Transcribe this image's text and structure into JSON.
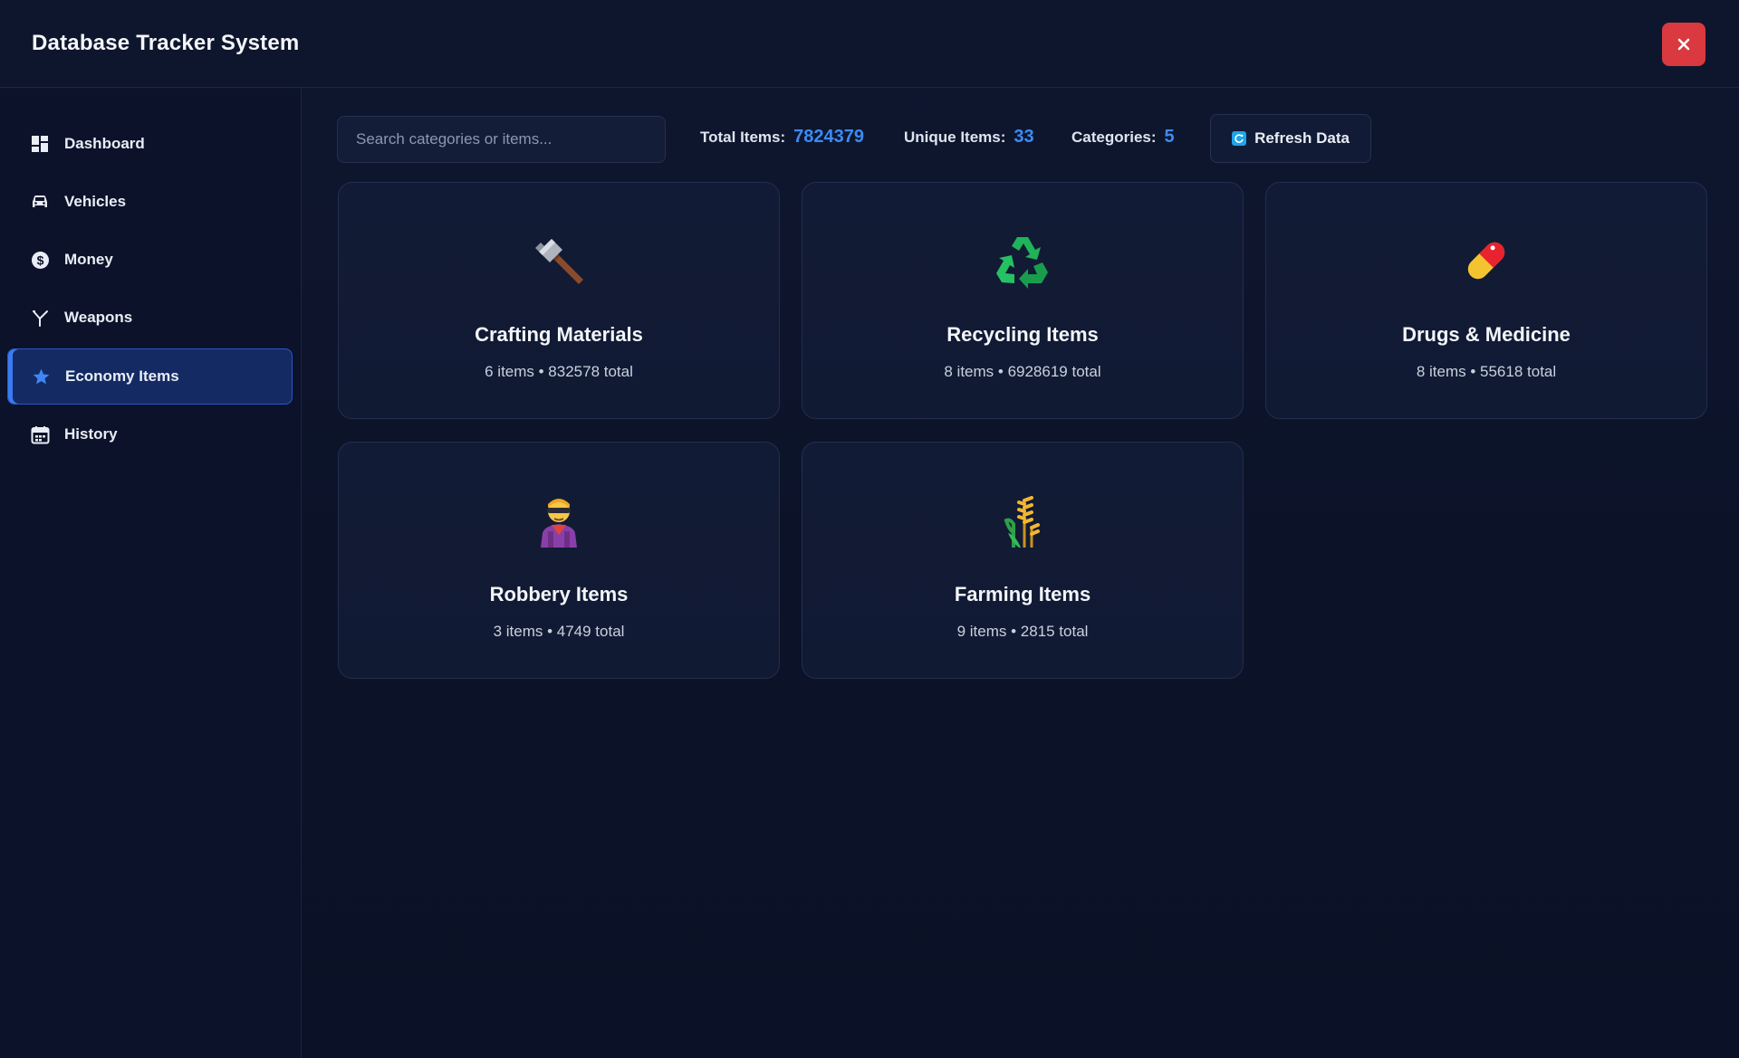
{
  "header": {
    "title": "Database Tracker System",
    "close_icon": "close-icon",
    "close_color": "#d9393f"
  },
  "sidebar": {
    "items": [
      {
        "label": "Dashboard",
        "icon": "dashboard-icon"
      },
      {
        "label": "Vehicles",
        "icon": "car-icon"
      },
      {
        "label": "Money",
        "icon": "dollar-icon"
      },
      {
        "label": "Weapons",
        "icon": "weapon-icon"
      },
      {
        "label": "Economy Items",
        "icon": "star-icon",
        "active": true
      },
      {
        "label": "History",
        "icon": "calendar-icon"
      }
    ]
  },
  "toolbar": {
    "search_placeholder": "Search categories or items...",
    "total_items_label": "Total Items:",
    "total_items_value": "7824379",
    "unique_items_label": "Unique Items:",
    "unique_items_value": "33",
    "categories_label": "Categories:",
    "categories_value": "5",
    "refresh_label": "Refresh Data",
    "accent_color": "#3d8bf2"
  },
  "categories": [
    {
      "title": "Crafting Materials",
      "meta": "6 items • 832578 total",
      "icon": "hammer-icon"
    },
    {
      "title": "Recycling Items",
      "meta": "8 items • 6928619 total",
      "icon": "recycle-icon"
    },
    {
      "title": "Drugs & Medicine",
      "meta": "8 items • 55618 total",
      "icon": "pill-icon"
    },
    {
      "title": "Robbery Items",
      "meta": "3 items • 4749 total",
      "icon": "robber-icon"
    },
    {
      "title": "Farming Items",
      "meta": "9 items • 2815 total",
      "icon": "wheat-icon"
    }
  ]
}
